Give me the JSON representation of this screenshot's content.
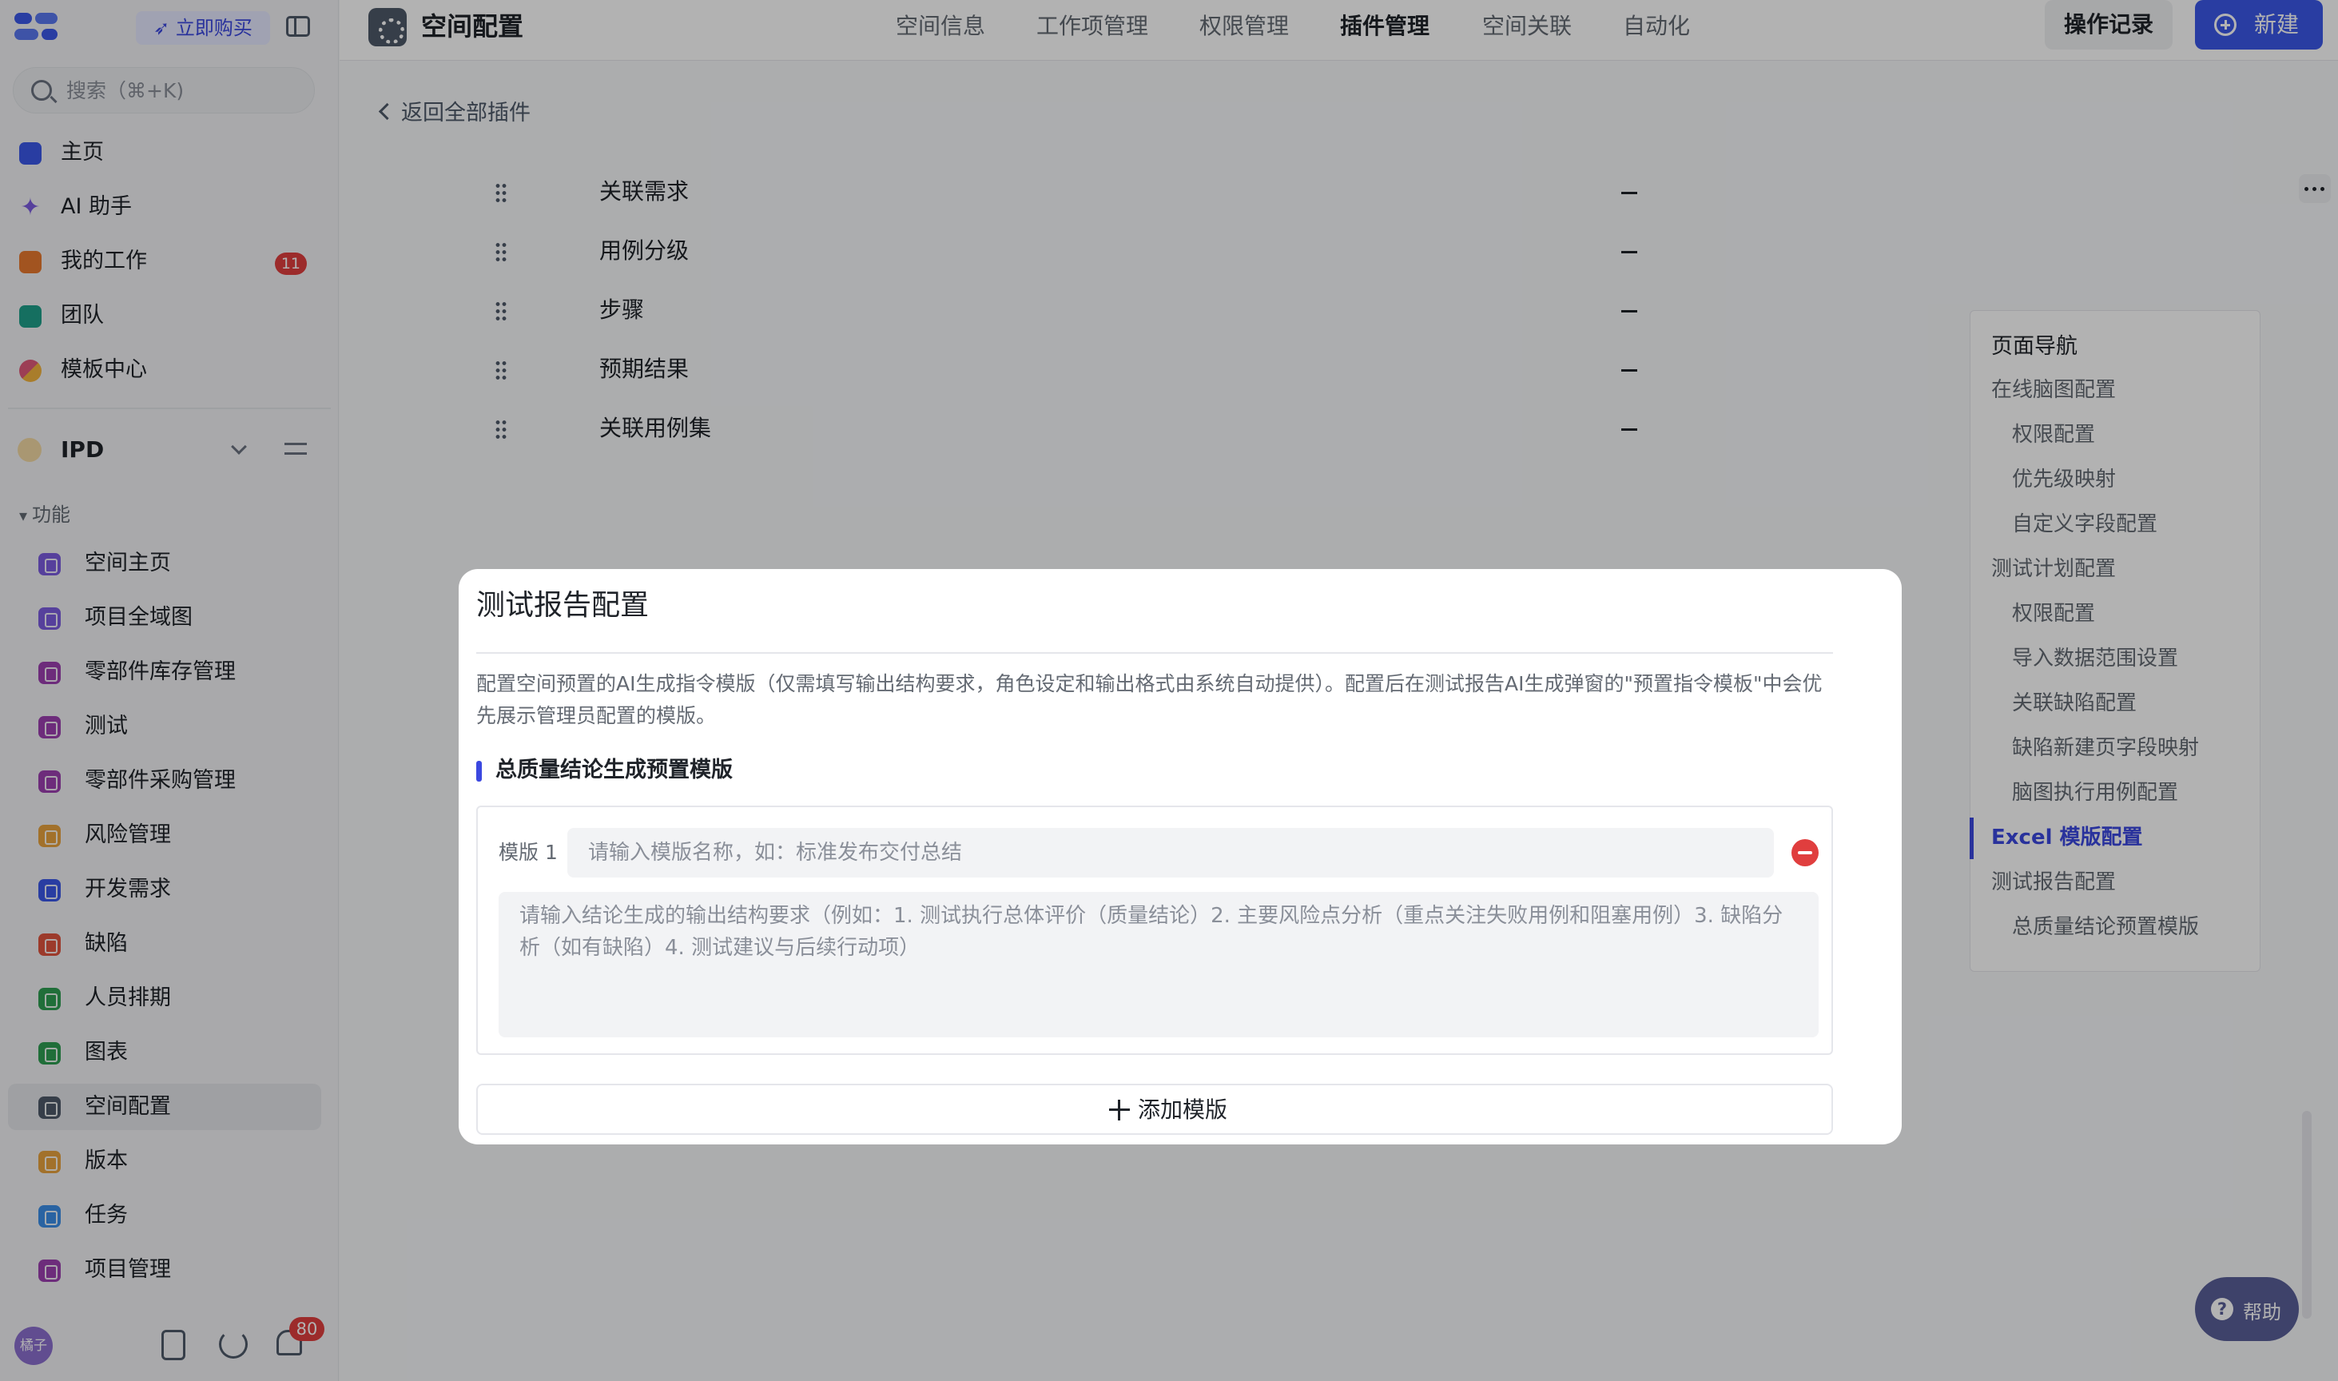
{
  "sidebar": {
    "buy_label": "立即购买",
    "search_placeholder": "搜索（⌘+K)",
    "nav": [
      {
        "label": "主页",
        "icon": "home-icon",
        "color": "#3b58e8"
      },
      {
        "label": "AI 助手",
        "icon": "sparkle-icon",
        "color": "#7b5ce0"
      },
      {
        "label": "我的工作",
        "icon": "user-icon",
        "color": "#e8792e",
        "badge": "11"
      },
      {
        "label": "团队",
        "icon": "team-icon",
        "color": "#1f9f8a"
      },
      {
        "label": "模板中心",
        "icon": "template-icon",
        "color": "#e05a7a"
      }
    ],
    "space": {
      "name": "IPD",
      "icon": "space-icon"
    },
    "section_title": "功能",
    "functions": [
      {
        "label": "空间主页",
        "color": "#7b5ce0"
      },
      {
        "label": "项目全域图",
        "color": "#7b5ce0"
      },
      {
        "label": "零部件库存管理",
        "color": "#9c3fb0"
      },
      {
        "label": "测试",
        "color": "#9c3fb0"
      },
      {
        "label": "零部件采购管理",
        "color": "#9c3fb0"
      },
      {
        "label": "风险管理",
        "color": "#e8a33e"
      },
      {
        "label": "开发需求",
        "color": "#3b58e8"
      },
      {
        "label": "缺陷",
        "color": "#e0543e"
      },
      {
        "label": "人员排期",
        "color": "#2e9e52"
      },
      {
        "label": "图表",
        "color": "#2e9e52"
      },
      {
        "label": "空间配置",
        "color": "#4e5969",
        "active": true
      },
      {
        "label": "版本",
        "color": "#e8a33e"
      },
      {
        "label": "任务",
        "color": "#3b8ee8"
      },
      {
        "label": "项目管理",
        "color": "#9c3fb0"
      }
    ],
    "footer": {
      "avatar_text": "橘子",
      "bell_badge": "80"
    }
  },
  "topbar": {
    "title": "空间配置",
    "tabs": [
      "空间信息",
      "工作项管理",
      "权限管理",
      "插件管理",
      "空间关联",
      "自动化"
    ],
    "active_tab": "插件管理",
    "log_label": "操作记录",
    "new_label": "新建"
  },
  "content": {
    "back_label": "返回全部插件",
    "fields": [
      {
        "name": "关联需求",
        "value": "–"
      },
      {
        "name": "用例分级",
        "value": "–"
      },
      {
        "name": "步骤",
        "value": "–"
      },
      {
        "name": "预期结果",
        "value": "–"
      },
      {
        "name": "关联用例集",
        "value": "–"
      }
    ]
  },
  "page_nav": {
    "title": "页面导航",
    "items": [
      {
        "label": "在线脑图配置",
        "level": 1
      },
      {
        "label": "权限配置",
        "level": 2
      },
      {
        "label": "优先级映射",
        "level": 2
      },
      {
        "label": "自定义字段配置",
        "level": 2
      },
      {
        "label": "测试计划配置",
        "level": 1
      },
      {
        "label": "权限配置",
        "level": 2
      },
      {
        "label": "导入数据范围设置",
        "level": 2
      },
      {
        "label": "关联缺陷配置",
        "level": 2
      },
      {
        "label": "缺陷新建页字段映射",
        "level": 2
      },
      {
        "label": "脑图执行用例配置",
        "level": 2
      },
      {
        "label": "Excel 模版配置",
        "level": 1,
        "active": true
      },
      {
        "label": "测试报告配置",
        "level": 1
      },
      {
        "label": "总质量结论预置模版",
        "level": 2
      }
    ]
  },
  "help_label": "帮助",
  "modal": {
    "title": "测试报告配置",
    "description": "配置空间预置的AI生成指令模版（仅需填写输出结构要求，角色设定和输出格式由系统自动提供）。配置后在测试报告AI生成弹窗的\"预置指令模板\"中会优先展示管理员配置的模版。",
    "section_title": "总质量结论生成预置模版",
    "template": {
      "label": "模版 1",
      "name_placeholder": "请输入模版名称，如：标准发布交付总结",
      "body_placeholder": "请输入结论生成的输出结构要求（例如：1. 测试执行总体评价（质量结论）2. 主要风险点分析（重点关注失败用例和阻塞用例）3. 缺陷分析（如有缺陷）4. 测试建议与后续行动项）"
    },
    "add_label": "添加模版"
  }
}
